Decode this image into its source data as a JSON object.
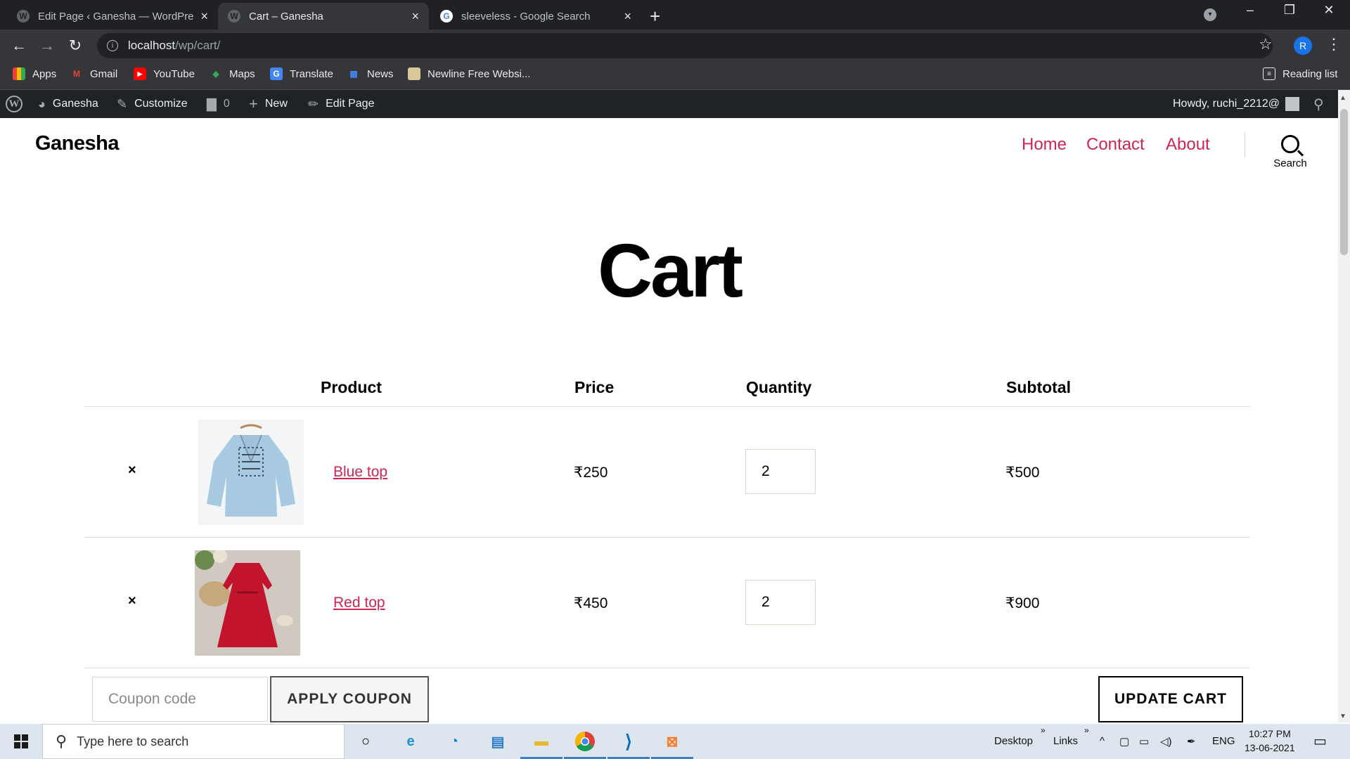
{
  "browser": {
    "tabs": [
      {
        "title": "Edit Page ‹ Ganesha — WordPress",
        "active": false
      },
      {
        "title": "Cart – Ganesha",
        "active": true
      },
      {
        "title": "sleeveless - Google Search",
        "active": false
      }
    ],
    "url_host": "localhost",
    "url_path": "/wp/cart/",
    "profile_initial": "R",
    "bookmarks": [
      "Apps",
      "Gmail",
      "YouTube",
      "Maps",
      "Translate",
      "News",
      "Newline Free Websi..."
    ],
    "reading_list": "Reading list"
  },
  "admin_bar": {
    "site_name": "Ganesha",
    "customize": "Customize",
    "comments_count": "0",
    "new": "New",
    "edit_page": "Edit Page",
    "howdy": "Howdy, ruchi_2212@"
  },
  "site": {
    "title": "Ganesha",
    "nav": [
      "Home",
      "Contact",
      "About"
    ],
    "search_label": "Search",
    "accent_color": "#cd2653"
  },
  "page": {
    "title": "Cart"
  },
  "cart": {
    "headers": {
      "product": "Product",
      "price": "Price",
      "quantity": "Quantity",
      "subtotal": "Subtotal"
    },
    "remove_symbol": "×",
    "items": [
      {
        "name": "Blue top",
        "price": "₹250",
        "quantity": "2",
        "subtotal": "₹500"
      },
      {
        "name": "Red top",
        "price": "₹450",
        "quantity": "2",
        "subtotal": "₹900"
      }
    ],
    "coupon_placeholder": "Coupon code",
    "apply_coupon": "APPLY COUPON",
    "update_cart": "UPDATE CART"
  },
  "taskbar": {
    "search_placeholder": "Type here to search",
    "desktop": "Desktop",
    "links": "Links",
    "language": "ENG",
    "time": "10:27 PM",
    "date": "13-06-2021"
  }
}
